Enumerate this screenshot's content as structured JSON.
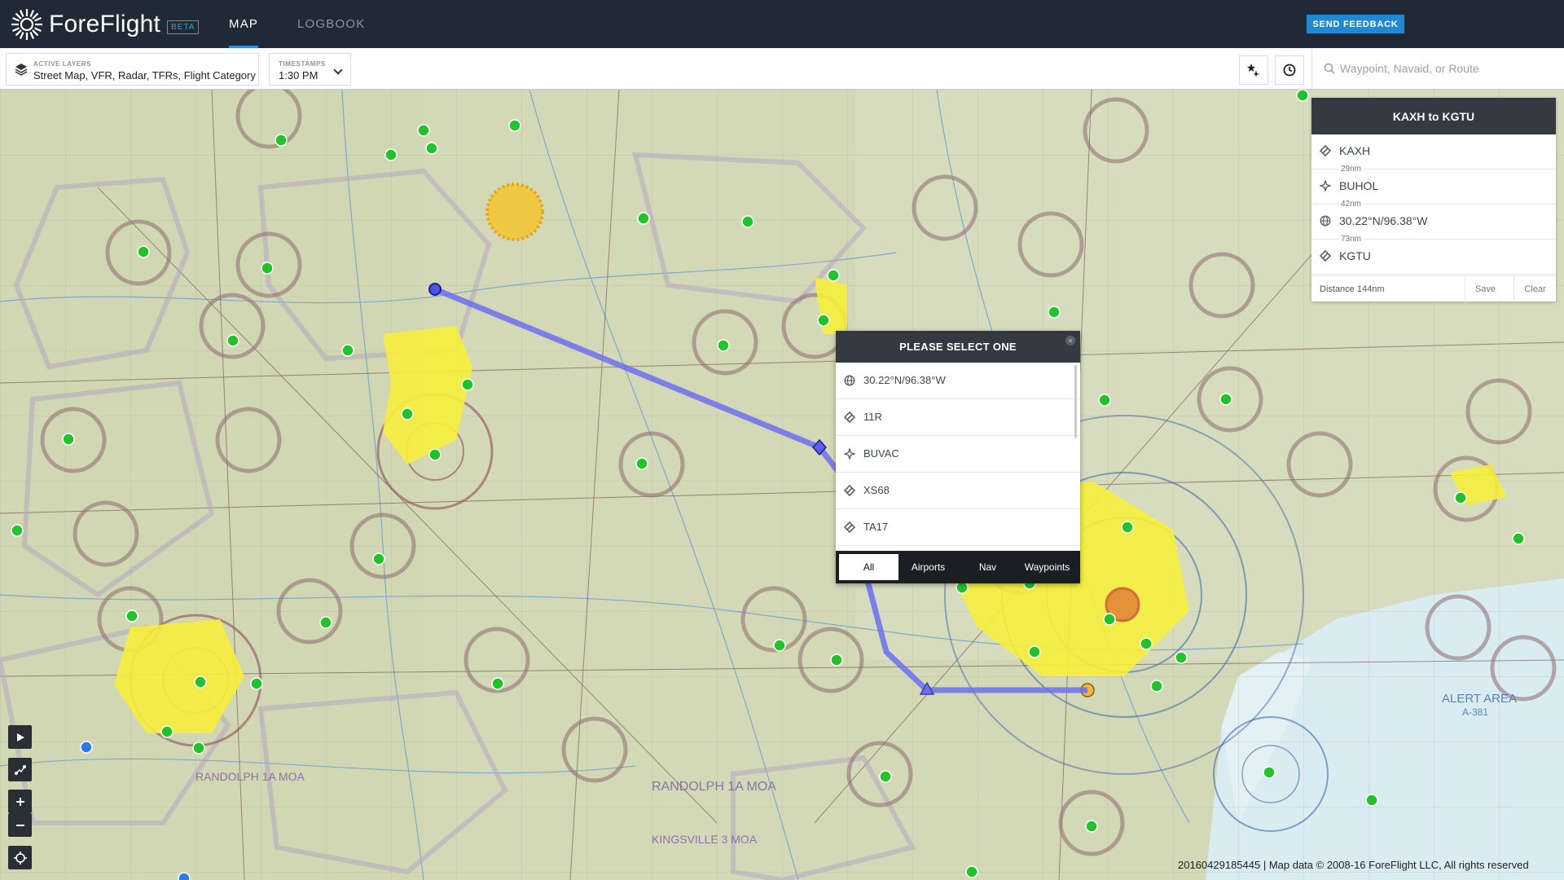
{
  "app": {
    "brand": "ForeFlight",
    "beta_badge": "BETA",
    "feedback_label": "SEND FEEDBACK",
    "nav_tabs": [
      {
        "label": "MAP",
        "active": true
      },
      {
        "label": "LOGBOOK",
        "active": false
      }
    ]
  },
  "toolbar": {
    "layers": {
      "caption": "ACTIVE LAYERS",
      "value": "Street Map, VFR, Radar, TFRs, Flight Category"
    },
    "timestamps": {
      "caption": "TIMESTAMPS",
      "value": "1:30 PM"
    },
    "search": {
      "placeholder": "Waypoint, Navaid, or Route"
    }
  },
  "route": {
    "title": "KAXH to KGTU",
    "items": [
      {
        "name": "KAXH",
        "icon": "airport-icon",
        "leg": "29nm"
      },
      {
        "name": "BUHOL",
        "icon": "waypoint-icon",
        "leg": "42nm"
      },
      {
        "name": "30.22°N/96.38°W",
        "icon": "globe-icon",
        "leg": "73nm"
      },
      {
        "name": "KGTU",
        "icon": "airport-icon",
        "leg": ""
      }
    ],
    "distance_label": "Distance 144nm",
    "save_label": "Save",
    "clear_label": "Clear"
  },
  "select_popup": {
    "title": "PLEASE SELECT ONE",
    "close": "×",
    "options": [
      {
        "name": "30.22°N/96.38°W",
        "icon": "globe-icon"
      },
      {
        "name": "11R",
        "icon": "airport-icon"
      },
      {
        "name": "BUVAC",
        "icon": "waypoint-icon"
      },
      {
        "name": "XS68",
        "icon": "airport-icon"
      },
      {
        "name": "TA17",
        "icon": "airport-icon"
      }
    ],
    "tabs": [
      {
        "label": "All",
        "active": true
      },
      {
        "label": "Airports",
        "active": false
      },
      {
        "label": "Nav",
        "active": false
      },
      {
        "label": "Waypoints",
        "active": false
      }
    ]
  },
  "map": {
    "footer": "20160429185445 | Map data © 2008-16 ForeFlight LLC, All rights reserved",
    "controls": [
      "play-icon",
      "route-icon",
      "zoom-in-icon",
      "zoom-out-icon",
      "locate-icon"
    ],
    "colors": {
      "route": "#6b6ff0",
      "vfr_airport": "#22c02a",
      "city": "#f7ee3a",
      "class_d": "#8d6a6f"
    }
  }
}
